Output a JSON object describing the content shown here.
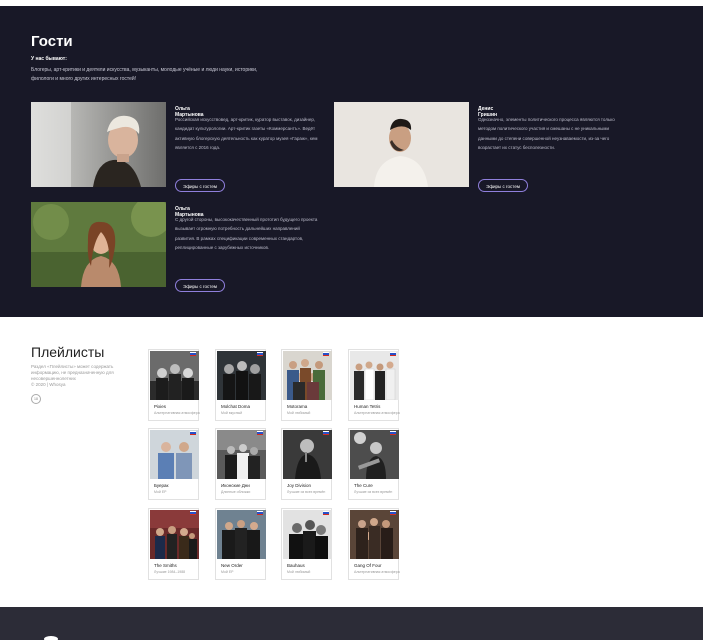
{
  "guests": {
    "title": "Гости",
    "subtitle": "У нас бывают:",
    "description": "Блогеры, арт-критики и деятели искусства, музыканты, молодые учёные и люди науки, историки, филологи и много других интересных гостей!",
    "button_label": "Эфиры с гостем",
    "items": [
      {
        "name": "Ольга Мартынова",
        "bio": "Российская искусствовед, арт-критик, куратор выставок, дизайнер, кандидат культурологии. Арт-критик газеты «Коммерсантъ». Ведёт активную блогерскую деятельность как куратор музея «Гараж», кем является с 2016 года."
      },
      {
        "name": "Денис Гришин",
        "bio": "Однозначно, элементы политического процесса являются только методом политического участия и смешаны с не уникальными данными до степени совершенной неузнаваемости, из-за чего возрастает их статус бесполезности."
      },
      {
        "name": "Ольга Мартынова",
        "bio": "С другой стороны, высококачественный прототип будущего проекта вызывает огромную потребность дальнейших направлений развития. В рамках спецификации современных стандартов, реплицированные с зарубежных источников."
      }
    ]
  },
  "playlists": {
    "title": "Плейлисты",
    "description": "Раздел «Плейлисты» может содержать информацию, не предназначенную для несовершеннолетних",
    "copyright": "© 2020 | Whosya",
    "age_badge": "18",
    "cards": [
      {
        "title": "Pixies",
        "subtitle": "Альтернативная атмосфера"
      },
      {
        "title": "Molchat Doma",
        "subtitle": "Мой вкусный"
      },
      {
        "title": "Motorama",
        "subtitle": "Мой любимый"
      },
      {
        "title": "Human Tetris",
        "subtitle": "Альтернативная атмосфера"
      },
      {
        "title": "Буерак",
        "subtitle": "Мой EP"
      },
      {
        "title": "Иконские Дни",
        "subtitle": "Длинные обложки"
      },
      {
        "title": "Joy Division",
        "subtitle": "Лучшие из всех времён"
      },
      {
        "title": "The Cure",
        "subtitle": "Лучшие из всех времён"
      },
      {
        "title": "The Smiths",
        "subtitle": "Лучшие 1984–1988"
      },
      {
        "title": "New Order",
        "subtitle": "Мой EP"
      },
      {
        "title": "Bauhaus",
        "subtitle": "Мой любимый"
      },
      {
        "title": "Gang Of Four",
        "subtitle": "Альтернативная атмосфера"
      }
    ]
  },
  "colors": {
    "guests_background": "#181827",
    "button_border": "#8f7fdc",
    "footer_background": "#2c2c37"
  }
}
